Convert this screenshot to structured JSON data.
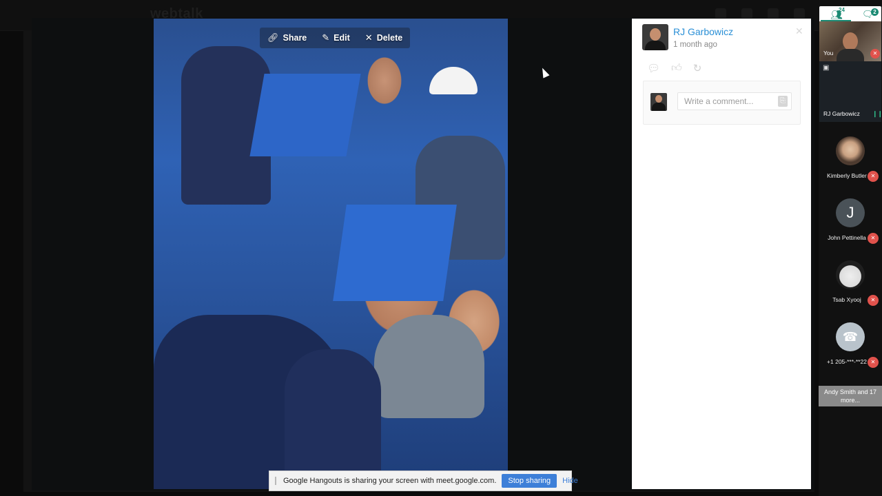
{
  "background": {
    "logo": "webtalk"
  },
  "image_toolbar": {
    "share_label": "Share",
    "edit_label": "Edit",
    "delete_label": "Delete"
  },
  "post_panel": {
    "author": "RJ Garbowicz",
    "time": "1 month ago",
    "comment_placeholder": "Write a comment..."
  },
  "share_bar": {
    "message": "Google Hangouts is sharing your screen with meet.google.com.",
    "stop_label": "Stop sharing",
    "hide_label": "Hide"
  },
  "meet_sidebar": {
    "people_count": "24",
    "chat_count": "2",
    "self_label": "You",
    "speaker_name": "RJ Garbowicz",
    "participants": [
      {
        "name": "Kimberly Butler",
        "initial": ""
      },
      {
        "name": "John Pettinella",
        "initial": "J"
      },
      {
        "name": "Tsab Xyooj",
        "initial": ""
      },
      {
        "name": "+1 205-***-**22",
        "initial": ""
      }
    ],
    "more_label": "Andy Smith and 17 more..."
  },
  "colors": {
    "link_blue": "#2a8fd6",
    "meet_green": "#1a8a73",
    "mute_red": "#e0524c",
    "stop_button": "#3d7fd8"
  }
}
